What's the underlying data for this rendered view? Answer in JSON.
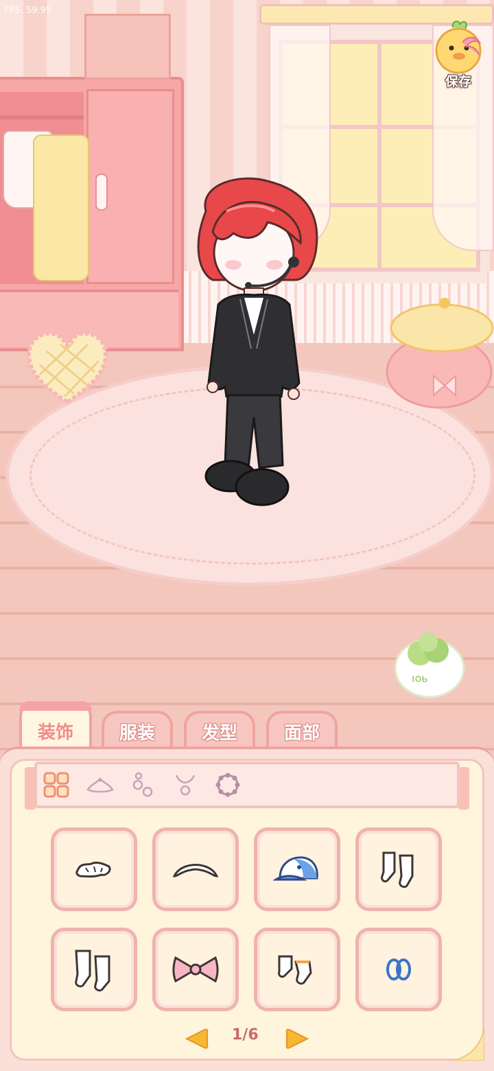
{
  "hud": {
    "fps_text": "FPS: 59.95"
  },
  "save": {
    "label": "保存",
    "icon": "duck-mascot-icon"
  },
  "tabs": [
    {
      "label": "装饰",
      "active": true
    },
    {
      "label": "服装",
      "active": false
    },
    {
      "label": "发型",
      "active": false
    },
    {
      "label": "面部",
      "active": false
    }
  ],
  "subcategories": [
    {
      "icon": "grid-all-icon",
      "active": true
    },
    {
      "icon": "tiara-icon",
      "active": false
    },
    {
      "icon": "earrings-icon",
      "active": false
    },
    {
      "icon": "necklace-icon",
      "active": false
    },
    {
      "icon": "bracelet-icon",
      "active": false
    }
  ],
  "items": [
    {
      "icon": "hair-scrunchie-icon"
    },
    {
      "icon": "headband-icon"
    },
    {
      "icon": "blue-cap-icon"
    },
    {
      "icon": "white-socks-icon"
    },
    {
      "icon": "white-socks-tall-icon"
    },
    {
      "icon": "pink-bow-icon"
    },
    {
      "icon": "ankle-socks-icon"
    },
    {
      "icon": "blue-rings-icon"
    }
  ],
  "pagination": {
    "text": "1/6"
  },
  "colors": {
    "accent": "#f08c8c",
    "panel": "#fff4dc",
    "arrow": "#f7b731"
  }
}
